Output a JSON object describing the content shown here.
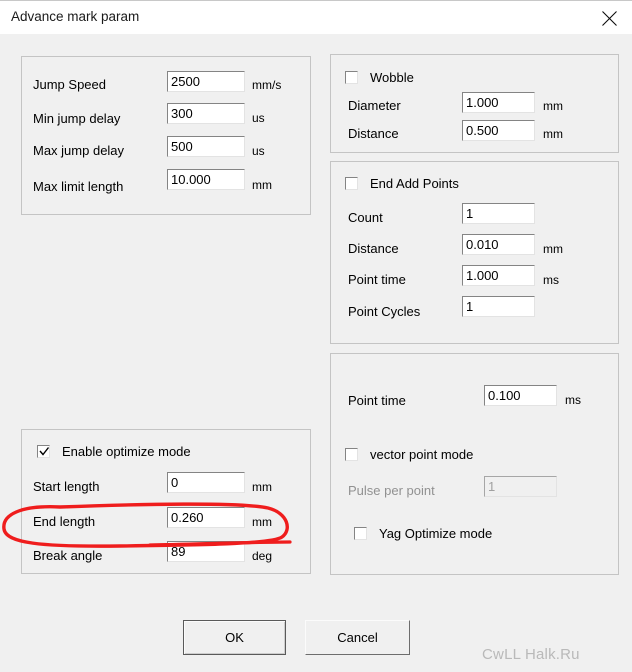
{
  "window": {
    "title": "Advance mark param",
    "close_icon": "close-icon"
  },
  "jump_group": {
    "rows": [
      {
        "label": "Jump Speed",
        "value": "2500",
        "unit": "mm/s"
      },
      {
        "label": "Min jump delay",
        "value": "300",
        "unit": "us"
      },
      {
        "label": "Max jump delay",
        "value": "500",
        "unit": "us"
      },
      {
        "label": "Max limit length",
        "value": "10.000",
        "unit": "mm"
      }
    ]
  },
  "optimize_group": {
    "checkbox": {
      "label": "Enable optimize mode",
      "checked": true
    },
    "rows": [
      {
        "label": "Start length",
        "value": "0",
        "unit": "mm"
      },
      {
        "label": "End length",
        "value": "0.260",
        "unit": "mm"
      },
      {
        "label": "Break angle",
        "value": "89",
        "unit": "deg"
      }
    ]
  },
  "wobble_group": {
    "checkbox": {
      "label": "Wobble",
      "checked": false
    },
    "rows": [
      {
        "label": "Diameter",
        "value": "1.000",
        "unit": "mm"
      },
      {
        "label": "Distance",
        "value": "0.500",
        "unit": "mm"
      }
    ]
  },
  "end_add_points_group": {
    "checkbox": {
      "label": "End Add Points",
      "checked": false
    },
    "rows": [
      {
        "label": "Count",
        "value": "1",
        "unit": ""
      },
      {
        "label": "Distance",
        "value": "0.010",
        "unit": "mm"
      },
      {
        "label": "Point time",
        "value": "1.000",
        "unit": "ms"
      },
      {
        "label": "Point Cycles",
        "value": "1",
        "unit": ""
      }
    ]
  },
  "point_group": {
    "point_time": {
      "label": "Point time",
      "value": "0.100",
      "unit": "ms"
    },
    "vector_point_mode": {
      "label": "vector point mode",
      "checked": false
    },
    "pulse_per_point": {
      "label": "Pulse per point",
      "value": "1",
      "unit": "",
      "disabled": true
    },
    "yag_optimize_mode": {
      "label": "Yag Optimize mode",
      "checked": false
    }
  },
  "buttons": {
    "ok": "OK",
    "cancel": "Cancel"
  },
  "annotation": {
    "shape": "red-ellipse-highlight",
    "color": "#ef1d1d",
    "targets": "End length field"
  },
  "watermark": {
    "text": "CwLL Halk.Ru",
    "color": "#b9b9b9"
  }
}
